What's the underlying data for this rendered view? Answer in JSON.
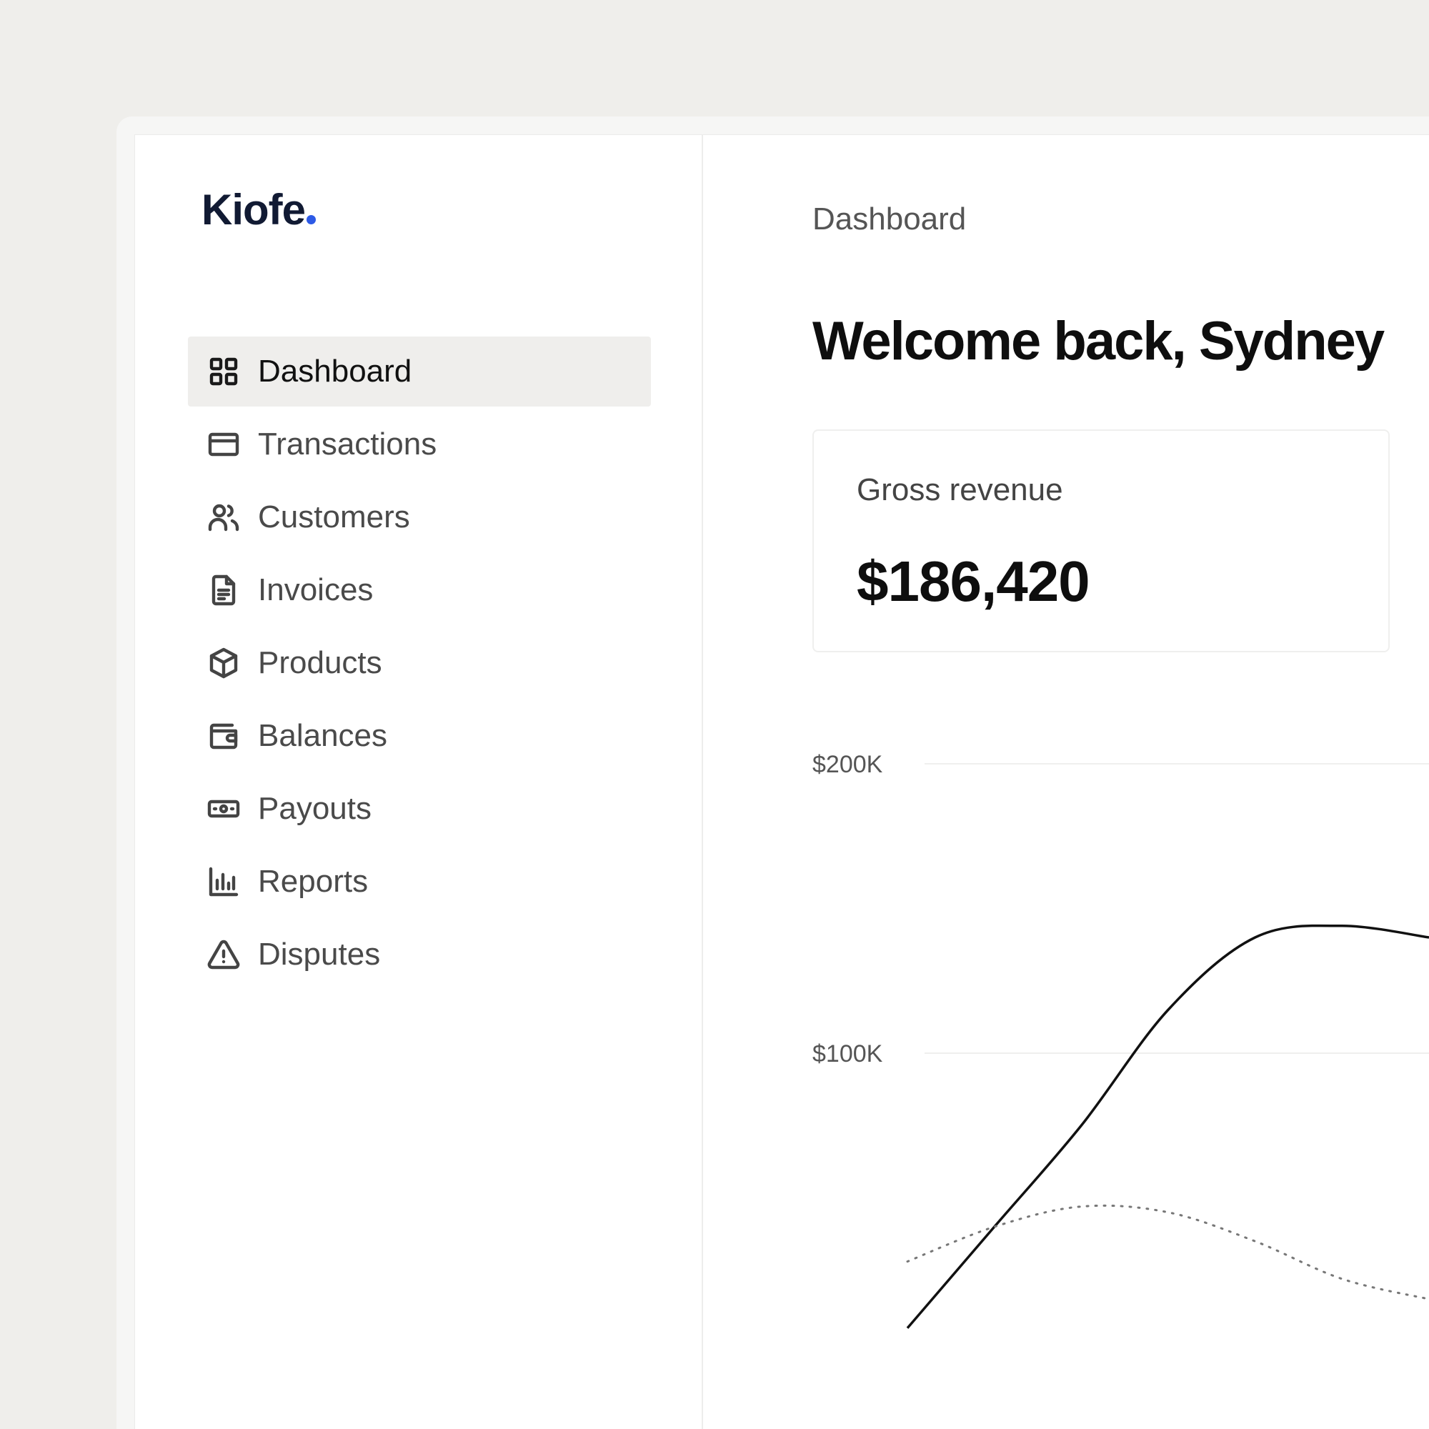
{
  "app": {
    "logo_text": "Kiofe",
    "accent_color": "#2d5ae6"
  },
  "sidebar": {
    "items": [
      {
        "label": "Dashboard",
        "icon": "grid-icon",
        "active": true
      },
      {
        "label": "Transactions",
        "icon": "credit-card-icon",
        "active": false
      },
      {
        "label": "Customers",
        "icon": "users-icon",
        "active": false
      },
      {
        "label": "Invoices",
        "icon": "file-text-icon",
        "active": false
      },
      {
        "label": "Products",
        "icon": "box-icon",
        "active": false
      },
      {
        "label": "Balances",
        "icon": "wallet-icon",
        "active": false
      },
      {
        "label": "Payouts",
        "icon": "banknote-icon",
        "active": false
      },
      {
        "label": "Reports",
        "icon": "bar-chart-icon",
        "active": false
      },
      {
        "label": "Disputes",
        "icon": "alert-triangle-icon",
        "active": false
      }
    ]
  },
  "main": {
    "breadcrumb": "Dashboard",
    "title": "Welcome back, Sydney",
    "card": {
      "label": "Gross revenue",
      "value": "$186,420"
    }
  },
  "chart_data": {
    "type": "line",
    "title": "",
    "xlabel": "",
    "ylabel": "",
    "y_ticks": [
      "$200K",
      "$100K"
    ],
    "ylim": [
      0,
      200000
    ],
    "grid": true,
    "series": [
      {
        "style": "solid",
        "x": [
          0,
          1,
          2,
          3,
          4,
          5,
          6
        ],
        "values": [
          5000,
          40000,
          75000,
          115000,
          140000,
          144000,
          140000
        ]
      },
      {
        "style": "dotted",
        "x": [
          0,
          1,
          2,
          3,
          4,
          5,
          6
        ],
        "values": [
          28000,
          40000,
          47000,
          45000,
          35000,
          22000,
          15000
        ]
      }
    ]
  }
}
